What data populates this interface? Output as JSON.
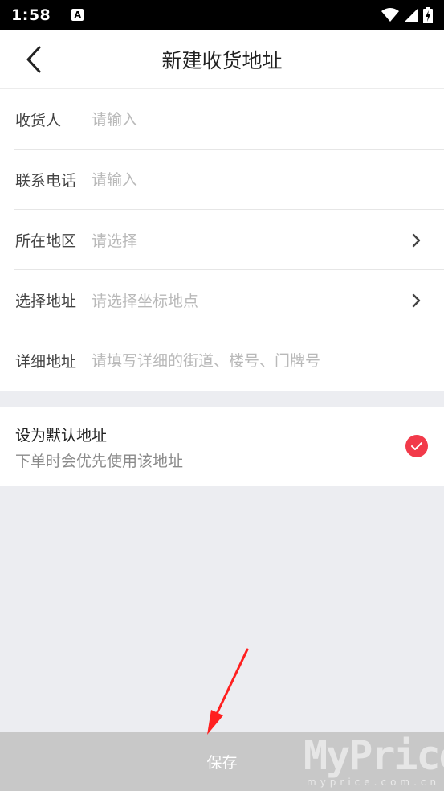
{
  "status_bar": {
    "time": "1:58",
    "notification_glyph": "A"
  },
  "header": {
    "title": "新建收货地址"
  },
  "form": {
    "rows": [
      {
        "label": "收货人",
        "placeholder": "请输入"
      },
      {
        "label": "联系电话",
        "placeholder": "请输入"
      },
      {
        "label": "所在地区",
        "placeholder": "请选择"
      },
      {
        "label": "选择地址",
        "placeholder": "请选择坐标地点"
      },
      {
        "label": "详细地址",
        "placeholder": "请填写详细的街道、楼号、门牌号"
      }
    ]
  },
  "default_address": {
    "title": "设为默认地址",
    "subtitle": "下单时会优先使用该地址",
    "checked": true
  },
  "save_button": {
    "label": "保存"
  },
  "watermark": {
    "main": "MyPrice",
    "sub": "myprice.com.cn"
  },
  "colors": {
    "accent": "#f23a4a",
    "annotation": "#ff2020",
    "save_bg": "#c8c8c8",
    "page_bg": "#ecedf1"
  }
}
